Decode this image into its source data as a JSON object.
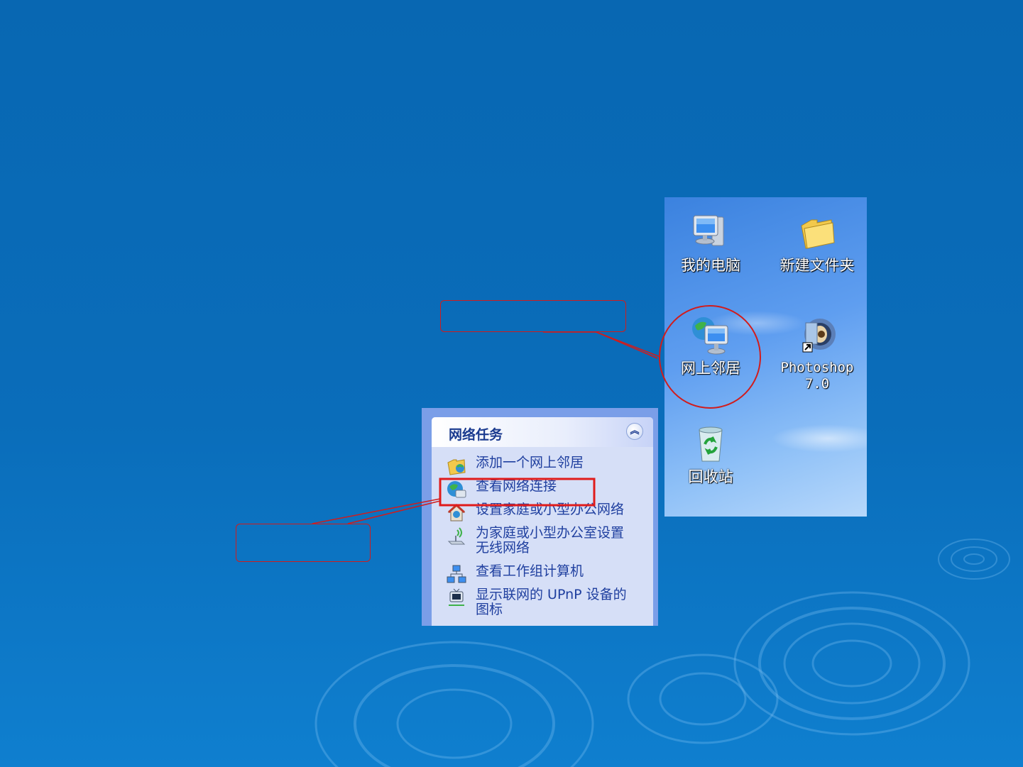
{
  "desktop": {
    "icons": [
      {
        "label": "我的电脑",
        "icon": "my-computer-icon"
      },
      {
        "label": "新建文件夹",
        "icon": "folder-icon"
      },
      {
        "label": "网上邻居",
        "icon": "network-places-icon"
      },
      {
        "label": "Photoshop 7.0",
        "icon": "photoshop-shortcut-icon"
      },
      {
        "label": "回收站",
        "icon": "recycle-bin-icon"
      }
    ]
  },
  "task_panel": {
    "title": "网络任务",
    "items": [
      {
        "label": "添加一个网上邻居",
        "icon": "add-network-place-icon"
      },
      {
        "label": "查看网络连接",
        "icon": "network-connections-icon"
      },
      {
        "label": "设置家庭或小型办公网络",
        "icon": "home-network-icon"
      },
      {
        "label": "为家庭或小型办公室设置无线网络",
        "icon": "wireless-network-icon"
      },
      {
        "label": "查看工作组计算机",
        "icon": "workgroup-icon"
      },
      {
        "label": "显示联网的 UPnP 设备的图标",
        "icon": "upnp-device-icon"
      }
    ]
  },
  "colors": {
    "callout": "#d11c1c",
    "task_link": "#1f3f9f",
    "panel_title": "#1a3a8f"
  }
}
